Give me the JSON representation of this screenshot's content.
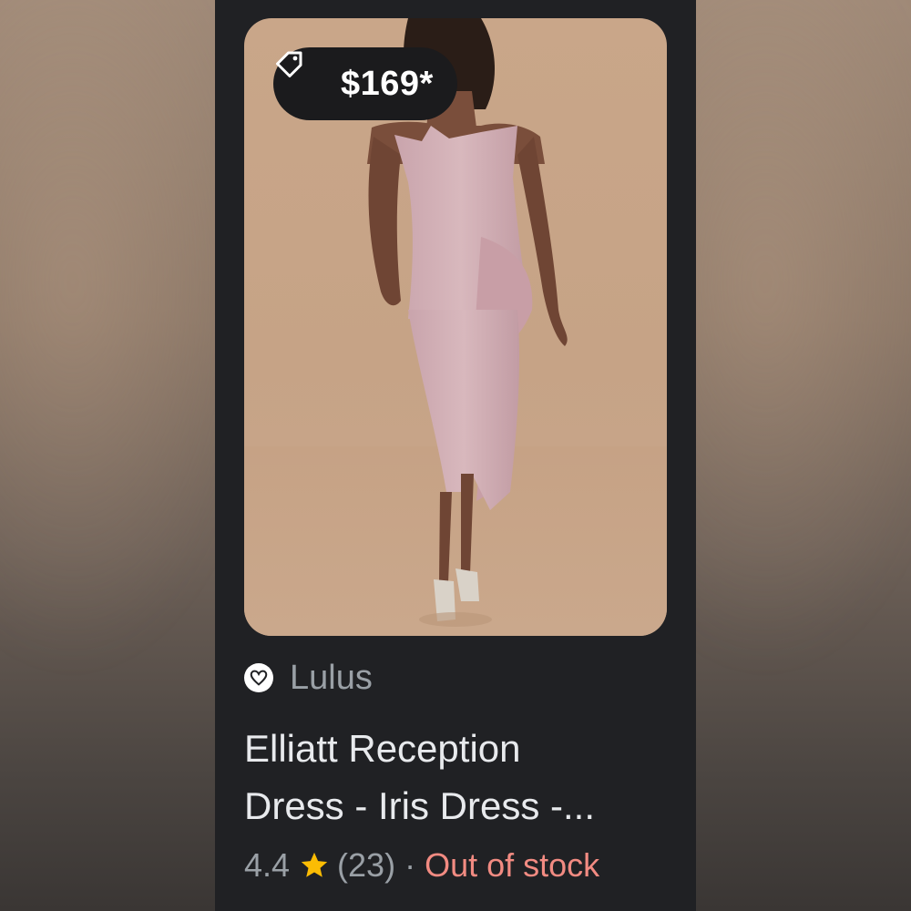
{
  "product": {
    "price": "$169*",
    "price_icon": "tag-icon",
    "merchant": "Lulus",
    "merchant_icon": "heart-logo-icon",
    "title_line1": "Elliatt Reception",
    "title_line2": "Dress - Iris Dress -...",
    "rating": "4.4",
    "rating_icon": "star-icon",
    "review_count": "(23)",
    "separator": "·",
    "stock_status": "Out of stock"
  },
  "colors": {
    "card_background": "#202124",
    "stock_status": "#f28b82",
    "star": "#fbbc04",
    "secondary_text": "#9aa0a6",
    "title_text": "#e8eaed"
  }
}
